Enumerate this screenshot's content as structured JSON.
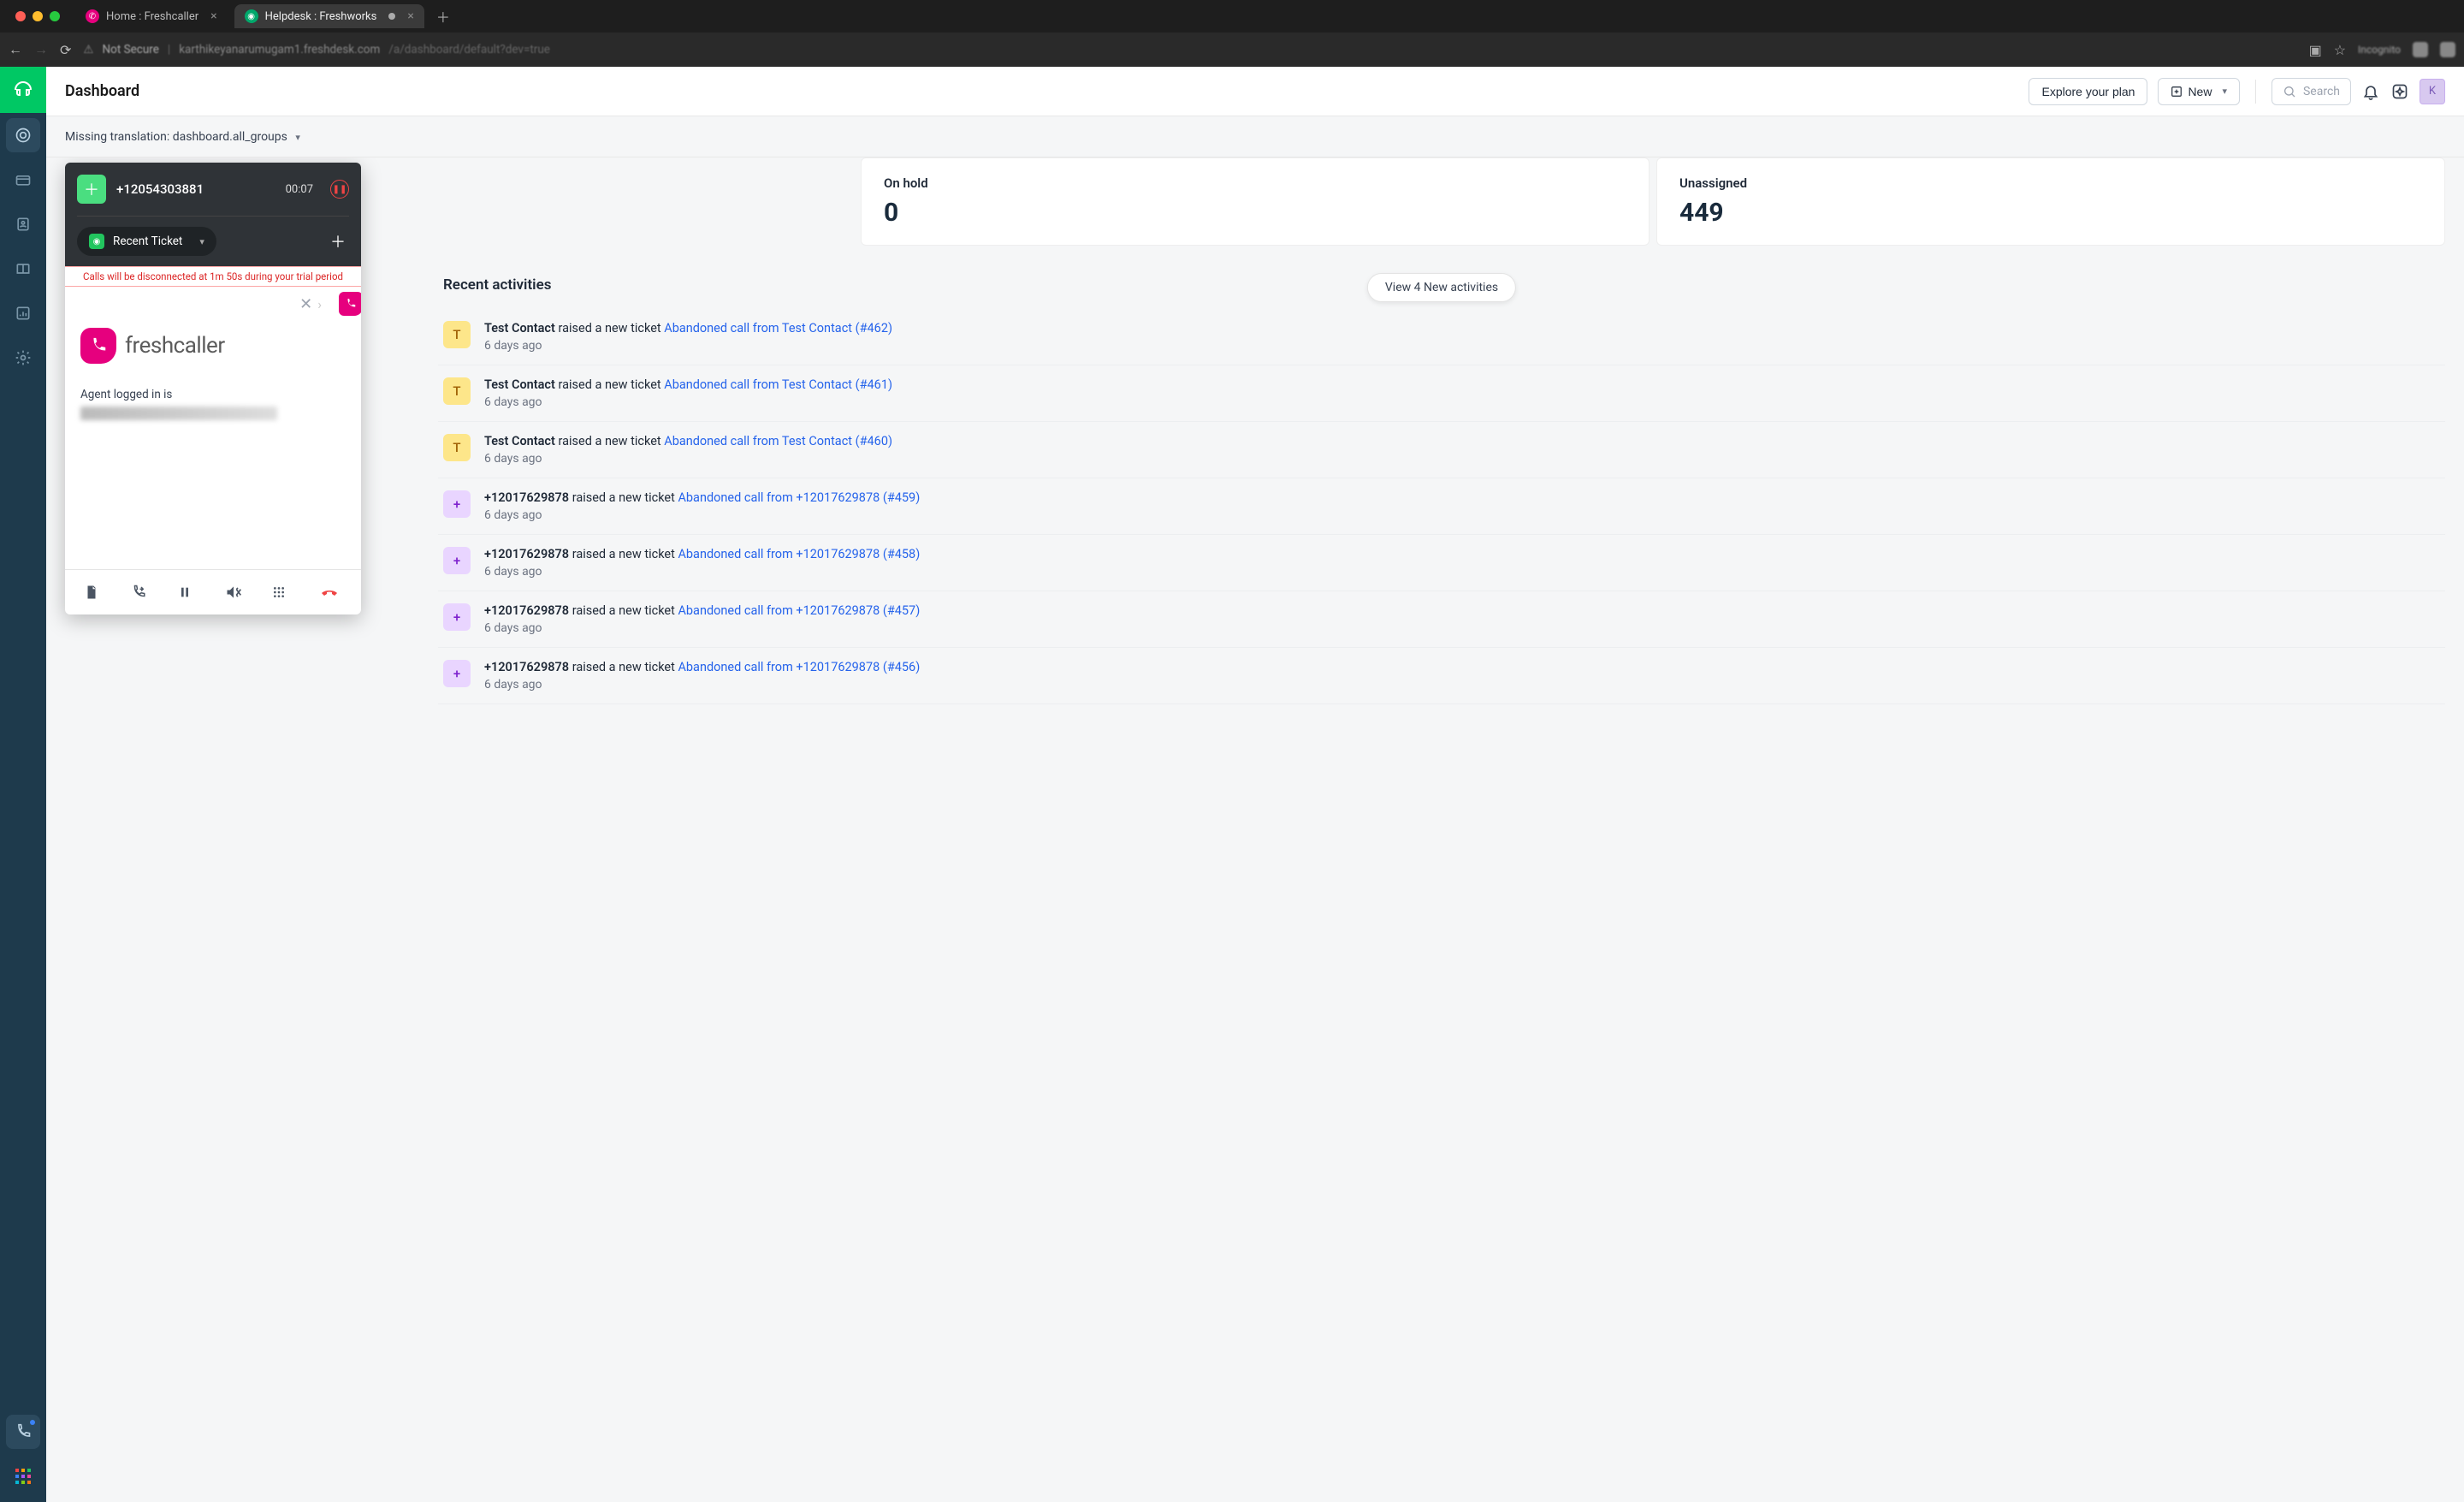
{
  "browser": {
    "tabs": [
      {
        "title": "Home : Freshcaller",
        "active": false
      },
      {
        "title": "Helpdesk : Freshworks",
        "active": true
      }
    ],
    "url_insecure": "Not Secure",
    "url_host": "karthikeyanarumugam1.freshdesk.com",
    "url_path": "/a/dashboard/default?dev=true",
    "incognito_label": "Incognito"
  },
  "page": {
    "title": "Dashboard",
    "explore_btn": "Explore your plan",
    "new_btn": "New",
    "search_placeholder": "Search",
    "avatar_letter": "K",
    "filter_text": "Missing translation: dashboard.all_groups"
  },
  "stats": {
    "onhold_label": "On hold",
    "onhold_value": "0",
    "unassigned_label": "Unassigned",
    "unassigned_value": "449"
  },
  "activities": {
    "heading": "Recent activities",
    "new_pill": "View 4 New activities",
    "action_text": "raised a new ticket",
    "items": [
      {
        "avatar": "T",
        "avatar_class": "av-yellow",
        "actor": "Test Contact",
        "link": "Abandoned call from Test Contact (#462)",
        "time": "6 days ago"
      },
      {
        "avatar": "T",
        "avatar_class": "av-yellow",
        "actor": "Test Contact",
        "link": "Abandoned call from Test Contact (#461)",
        "time": "6 days ago"
      },
      {
        "avatar": "T",
        "avatar_class": "av-yellow",
        "actor": "Test Contact",
        "link": "Abandoned call from Test Contact (#460)",
        "time": "6 days ago"
      },
      {
        "avatar": "+",
        "avatar_class": "av-purple",
        "actor": "+12017629878",
        "link": "Abandoned call from +12017629878 (#459)",
        "time": "6 days ago"
      },
      {
        "avatar": "+",
        "avatar_class": "av-purple",
        "actor": "+12017629878",
        "link": "Abandoned call from +12017629878 (#458)",
        "time": "6 days ago"
      },
      {
        "avatar": "+",
        "avatar_class": "av-purple",
        "actor": "+12017629878",
        "link": "Abandoned call from +12017629878 (#457)",
        "time": "6 days ago"
      },
      {
        "avatar": "+",
        "avatar_class": "av-purple",
        "actor": "+12017629878",
        "link": "Abandoned call from +12017629878 (#456)",
        "time": "6 days ago"
      }
    ]
  },
  "call_widget": {
    "number": "+12054303881",
    "timer": "00:07",
    "ticket_btn": "Recent Ticket",
    "warning": "Calls will be disconnected at 1m 50s during your trial period",
    "brand": "freshcaller",
    "agent_label": "Agent logged in is"
  }
}
